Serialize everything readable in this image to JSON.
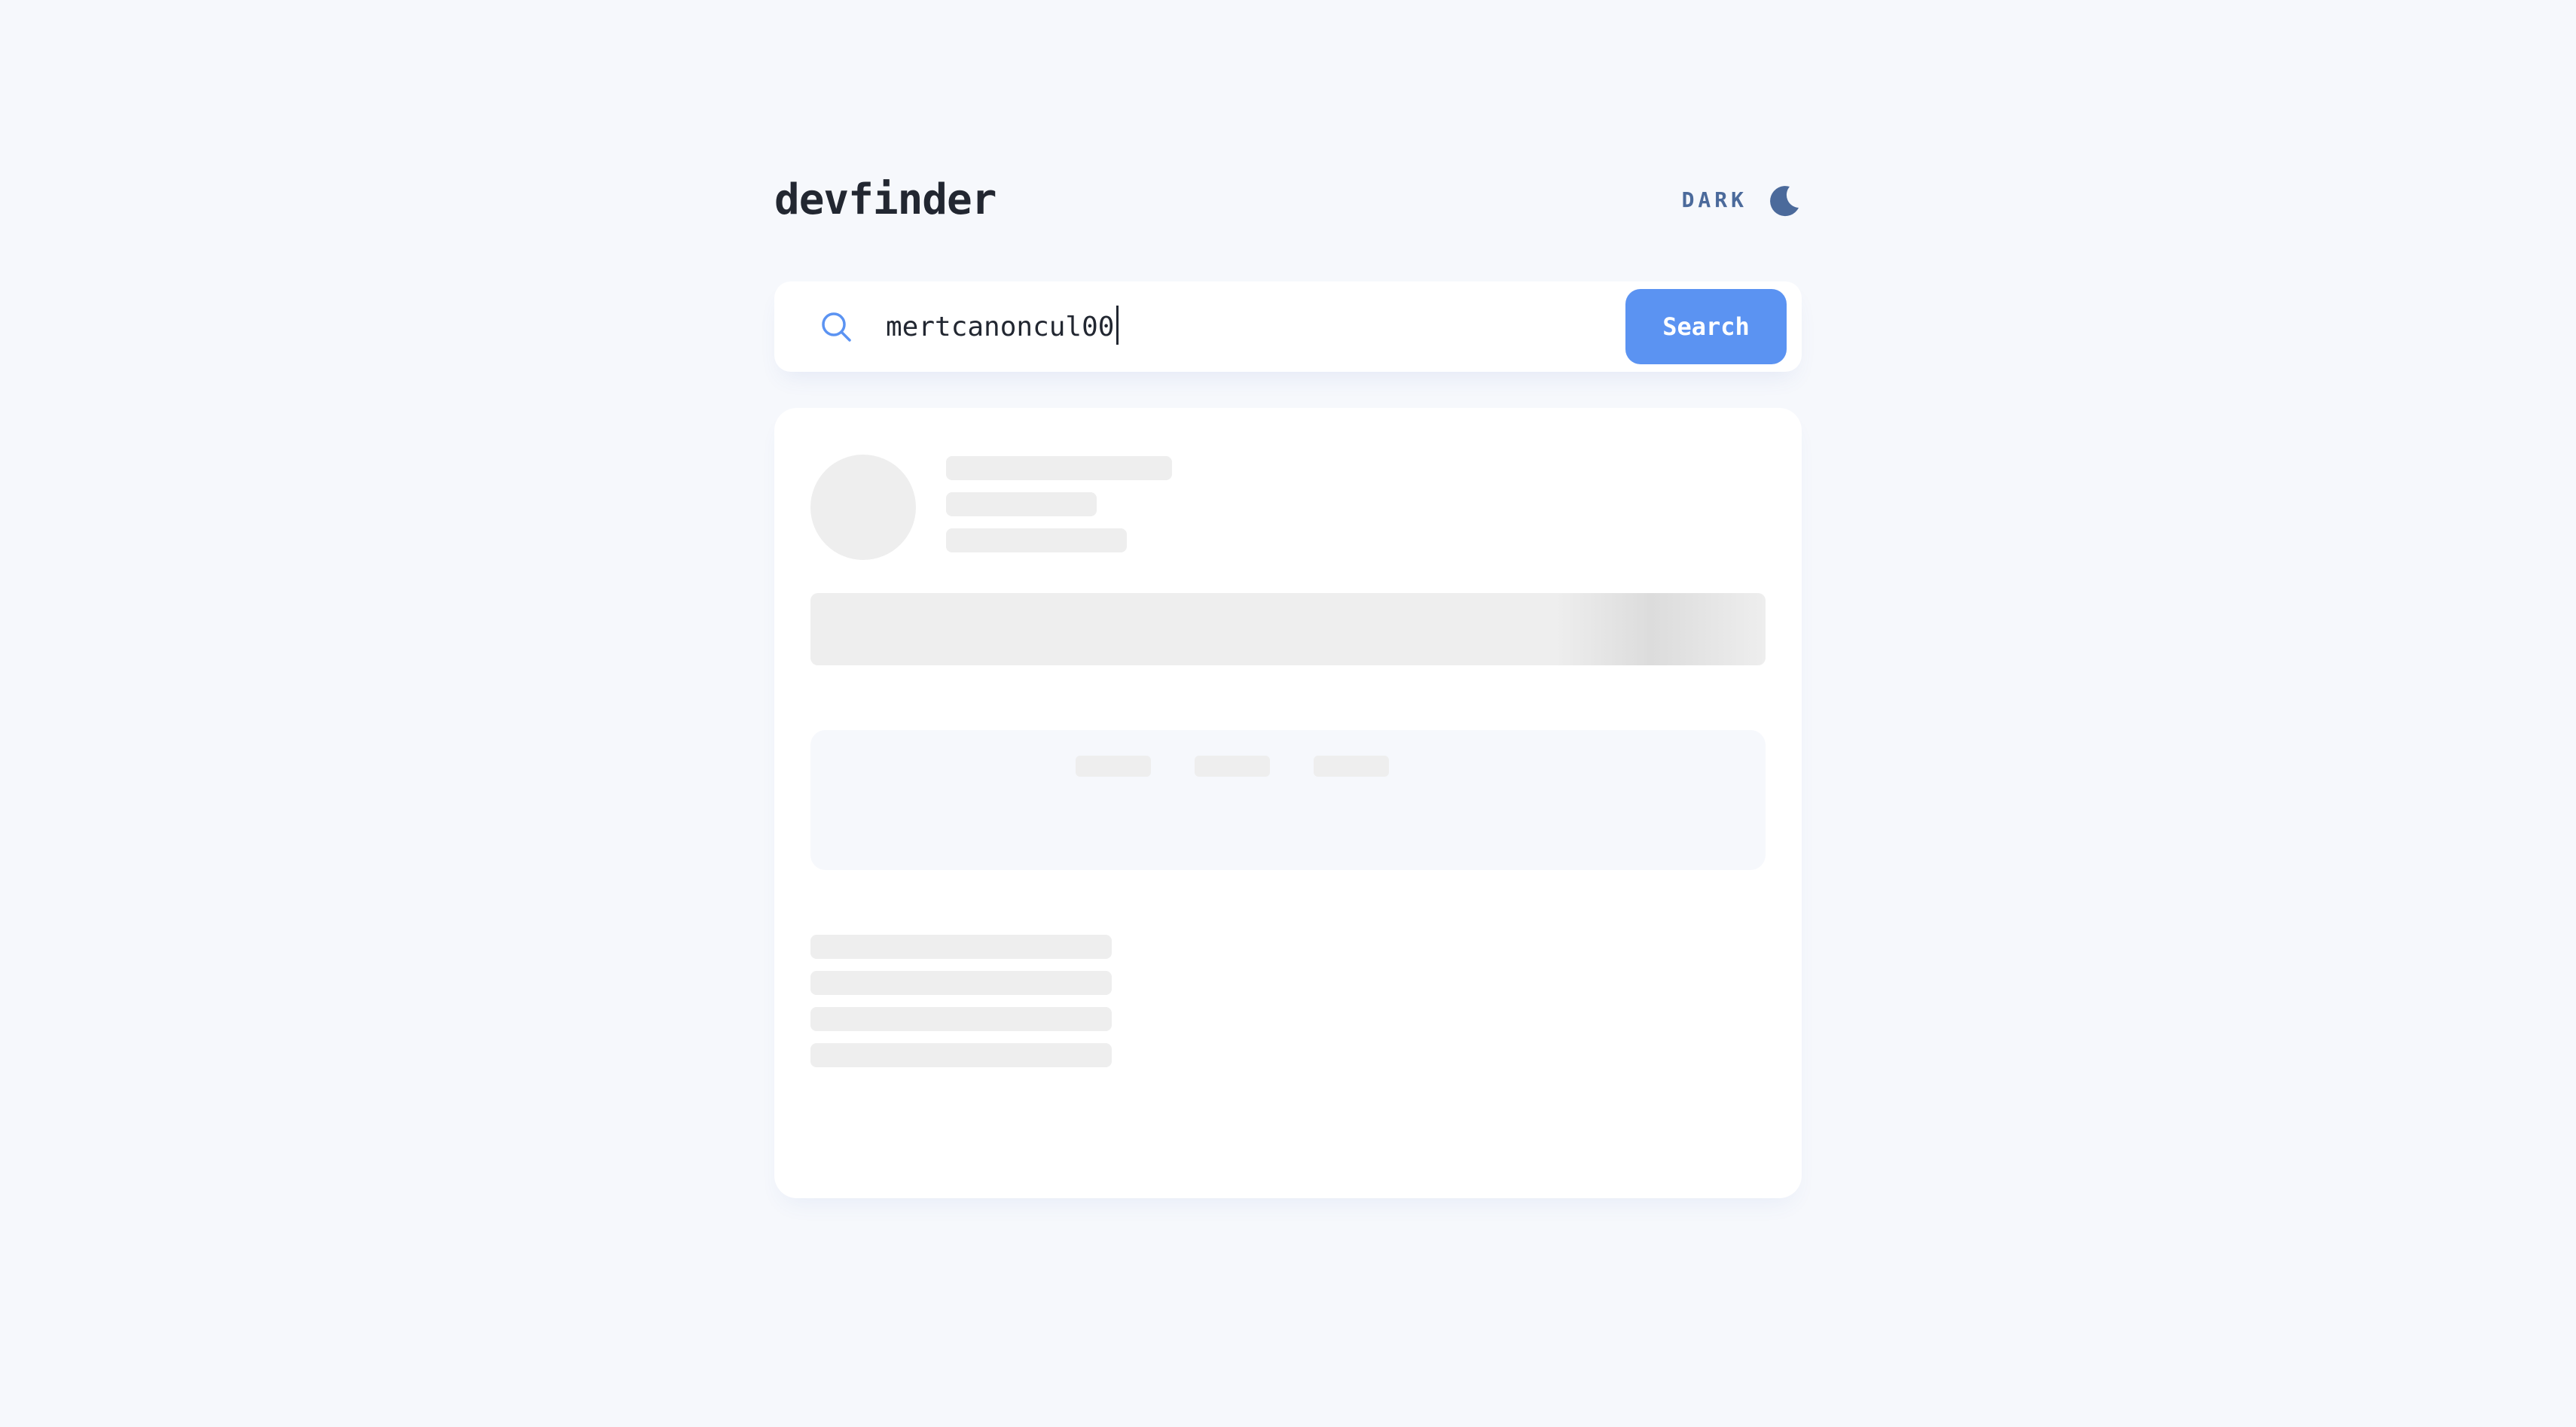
{
  "header": {
    "title": "devfinder",
    "theme_toggle_label": "DARK",
    "theme_icon": "moon-icon"
  },
  "search": {
    "icon": "search-icon",
    "value": "mertcanoncul00",
    "button_label": "Search"
  },
  "colors": {
    "background": "#f6f8fc",
    "card": "#ffffff",
    "accent": "#5b93f2",
    "text": "#222731",
    "toggle": "#4b6a9b",
    "skeleton": "#eeeeee"
  }
}
